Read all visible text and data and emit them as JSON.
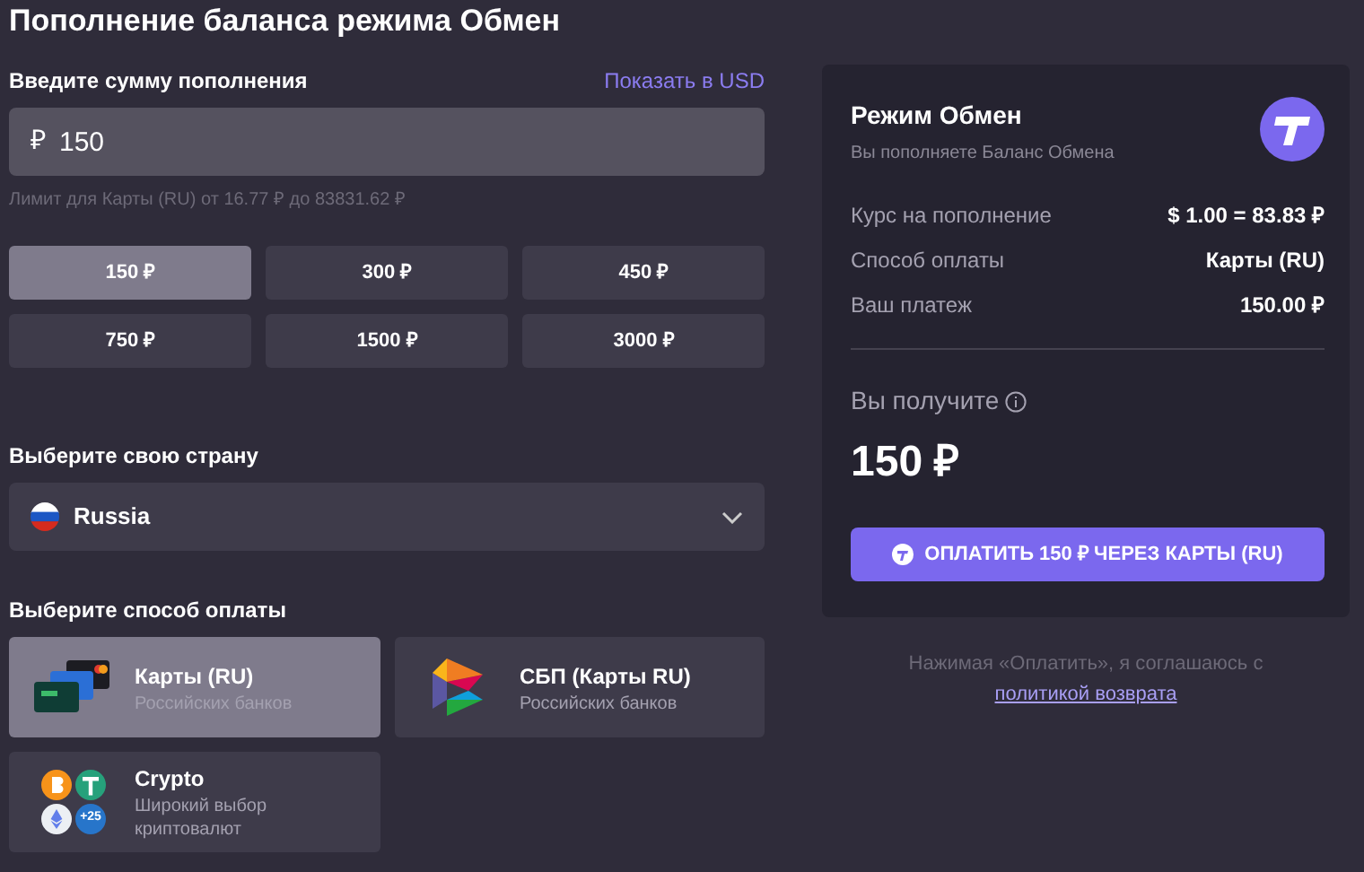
{
  "title": "Пополнение баланса режима Обмен",
  "amount": {
    "label": "Введите сумму пополнения",
    "toggle": "Показать в USD",
    "currency": "₽",
    "value": "150",
    "limit": "Лимит для Карты (RU) от 16.77 ₽ до 83831.62 ₽"
  },
  "presets": [
    {
      "label": "150 ₽",
      "selected": true
    },
    {
      "label": "300 ₽",
      "selected": false
    },
    {
      "label": "450 ₽",
      "selected": false
    },
    {
      "label": "750 ₽",
      "selected": false
    },
    {
      "label": "1500 ₽",
      "selected": false
    },
    {
      "label": "3000 ₽",
      "selected": false
    }
  ],
  "country": {
    "label": "Выберите свою страну",
    "value": "Russia"
  },
  "methods_label": "Выберите способ оплаты",
  "methods": [
    {
      "kind": "cards",
      "name": "Карты (RU)",
      "note": "Российских банков",
      "selected": true
    },
    {
      "kind": "sbp",
      "name": "СБП (Карты RU)",
      "note": "Российских банков",
      "selected": false
    },
    {
      "kind": "crypto",
      "name": "Crypto",
      "note": "Широкий выбор криптовалют",
      "badge": "+25",
      "selected": false
    }
  ],
  "summary": {
    "title": "Режим Обмен",
    "subtitle": "Вы пополняете Баланс Обмена",
    "rows": [
      {
        "label": "Курс на пополнение",
        "value": "$ 1.00 = 83.83 ₽"
      },
      {
        "label": "Способ оплаты",
        "value": "Карты (RU)"
      },
      {
        "label": "Ваш платеж",
        "value": "150.00 ₽"
      }
    ],
    "receive_label": "Вы получите",
    "receive_value": "150 ₽",
    "pay_button": "ОПЛАТИТЬ 150 ₽ ЧЕРЕЗ КАРТЫ (RU)",
    "terms": "Нажимая «Оплатить», я соглашаюсь с",
    "terms_link": "политикой возврата"
  }
}
